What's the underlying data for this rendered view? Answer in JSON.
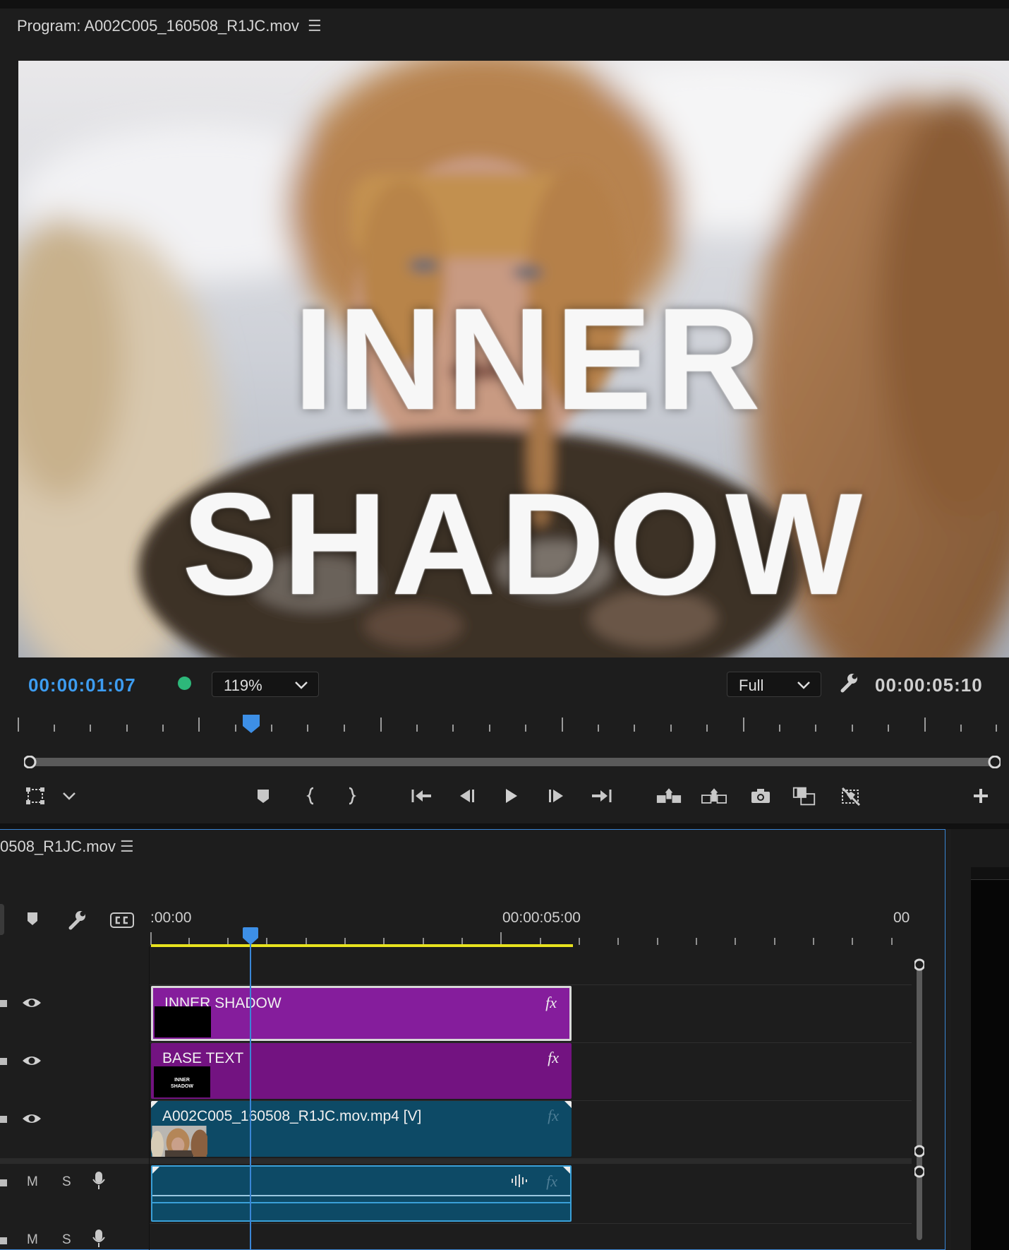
{
  "program_monitor": {
    "title": "Program: A002C005_160508_R1JC.mov",
    "menu_icon": "hamburger-icon",
    "overlay_line1": "INNER",
    "overlay_line2": "SHADOW",
    "current_timecode": "00:00:01:07",
    "zoom": "119%",
    "quality": "Full",
    "duration_timecode": "00:00:05:10",
    "playhead_fraction": 0.233,
    "transport_icons": [
      "add-marker-icon",
      "mark-in-icon",
      "mark-out-icon",
      "go-to-in-icon",
      "step-back-icon",
      "play-icon",
      "step-forward-icon",
      "go-to-out-icon",
      "lift-icon",
      "extract-icon",
      "export-frame-icon",
      "comparison-view-icon",
      "toggle-proxies-icon",
      "add-button-icon"
    ]
  },
  "timeline": {
    "title": "0508_R1JC.mov",
    "time_start": ":00:00",
    "time_mid": "00:00:05:00",
    "time_end": "00",
    "clips": {
      "inner_shadow": "INNER SHADOW",
      "base_text": "BASE TEXT",
      "video": "A002C005_160508_R1JC.mov.mp4 [V]",
      "thumb_text_1": "INNER",
      "thumb_text_2": "SHADOW",
      "fx": "fx"
    },
    "audio_track_1": {
      "mute": "M",
      "solo": "S"
    },
    "audio_track_2": {
      "mute": "M",
      "solo": "S"
    }
  },
  "colors": {
    "timecode_blue": "#3d9cf0",
    "status_green": "#2db87a",
    "graphic_clip": "#851d9c",
    "video_clip": "#0d4a66",
    "work_area": "#e7e21e",
    "panel_border": "#3a86d6"
  }
}
